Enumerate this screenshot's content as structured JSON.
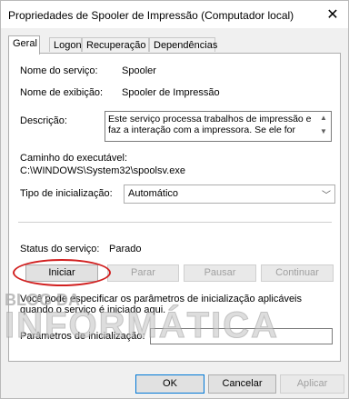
{
  "window": {
    "title": "Propriedades de Spooler de Impressão (Computador local)",
    "close_glyph": "✕"
  },
  "tabs": [
    {
      "label": "Geral",
      "active": true
    },
    {
      "label": "Logon",
      "active": false
    },
    {
      "label": "Recuperação",
      "active": false
    },
    {
      "label": "Dependências",
      "active": false
    }
  ],
  "general": {
    "service_name_label": "Nome do serviço:",
    "service_name_value": "Spooler",
    "display_name_label": "Nome de exibição:",
    "display_name_value": "Spooler de Impressão",
    "description_label": "Descrição:",
    "description_value": "Este serviço processa trabalhos de impressão e faz a interação com a impressora. Se ele for",
    "exec_path_label": "Caminho do executável:",
    "exec_path_value": "C:\\WINDOWS\\System32\\spoolsv.exe",
    "startup_type_label": "Tipo de inicialização:",
    "startup_type_value": "Automático",
    "status_label": "Status do serviço:",
    "status_value": "Parado",
    "buttons": {
      "start": "Iniciar",
      "stop": "Parar",
      "pause": "Pausar",
      "resume": "Continuar"
    },
    "params_help": "Você pode especificar os parâmetros de inicialização aplicáveis quando o serviço é iniciado aqui.",
    "params_label": "Parâmetros de inicialização:",
    "params_value": ""
  },
  "watermark": {
    "line1": "BLOG DA",
    "line2": "INFORMÁTICA"
  },
  "footer": {
    "ok": "OK",
    "cancel": "Cancelar",
    "apply": "Aplicar"
  },
  "colors": {
    "highlight_oval": "#d12020",
    "accent": "#0078d7"
  }
}
